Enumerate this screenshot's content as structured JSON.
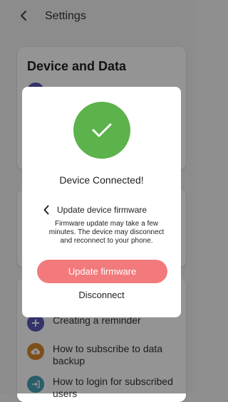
{
  "header": {
    "title": "Settings",
    "back_icon": "chevron-left-icon"
  },
  "device_card": {
    "title": "Device and Data"
  },
  "help_list": {
    "items": [
      {
        "label": "Creating a reminder",
        "icon": "plus-icon",
        "color": "#5a58b8"
      },
      {
        "label": "How to subscribe to data backup",
        "icon": "cloud-upload-icon",
        "color": "#d98a2b"
      },
      {
        "label": "How to login for subscribed users",
        "icon": "login-icon",
        "color": "#45a0b5"
      }
    ]
  },
  "dialog": {
    "status_icon": "check-icon",
    "status_color": "#5cb24b",
    "title": "Device Connected!",
    "firmware": {
      "label": "Update device firmware",
      "description": "Firmware update may take a few minutes. The device may disconnect and reconnect to your phone."
    },
    "primary_button": "Update firmware",
    "primary_color": "#f27a7c",
    "secondary_button": "Disconnect"
  }
}
